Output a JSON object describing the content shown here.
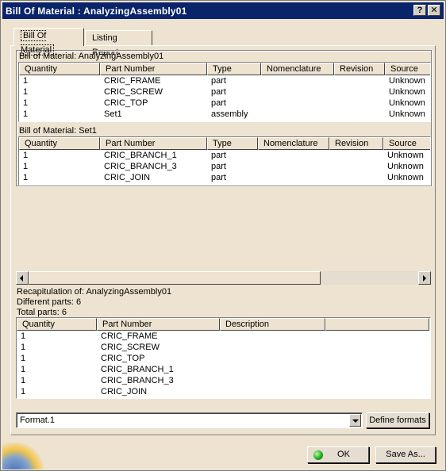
{
  "window": {
    "title": "Bill Of Material : AnalyzingAssembly01",
    "help": "?",
    "close": "✕"
  },
  "tabs": [
    {
      "label": "Bill Of Material"
    },
    {
      "label": "Listing Report"
    }
  ],
  "bom1": {
    "label": "Bill of Material: AnalyzingAssembly01",
    "columns": [
      "Quantity",
      "Part Number",
      "Type",
      "Nomenclature",
      "Revision",
      "Source"
    ],
    "rows": [
      [
        "1",
        "CRIC_FRAME",
        "part",
        "",
        "",
        "Unknown"
      ],
      [
        "1",
        "CRIC_SCREW",
        "part",
        "",
        "",
        "Unknown"
      ],
      [
        "1",
        "CRIC_TOP",
        "part",
        "",
        "",
        "Unknown"
      ],
      [
        "1",
        "Set1",
        "assembly",
        "",
        "",
        "Unknown"
      ]
    ]
  },
  "bom2": {
    "label": "Bill of Material: Set1",
    "columns": [
      "Quantity",
      "Part Number",
      "Type",
      "Nomenclature",
      "Revision",
      "Source"
    ],
    "rows": [
      [
        "1",
        "CRIC_BRANCH_1",
        "part",
        "",
        "",
        "Unknown"
      ],
      [
        "1",
        "CRIC_BRANCH_3",
        "part",
        "",
        "",
        "Unknown"
      ],
      [
        "1",
        "CRIC_JOIN",
        "part",
        "",
        "",
        "Unknown"
      ]
    ]
  },
  "recap": {
    "title": "Recapitulation of: AnalyzingAssembly01",
    "different": "Different parts: 6",
    "total": "Total parts: 6",
    "columns": [
      "Quantity",
      "Part Number",
      "Description",
      ""
    ],
    "rows": [
      [
        "1",
        "CRIC_FRAME",
        "",
        ""
      ],
      [
        "1",
        "CRIC_SCREW",
        "",
        ""
      ],
      [
        "1",
        "CRIC_TOP",
        "",
        ""
      ],
      [
        "1",
        "CRIC_BRANCH_1",
        "",
        ""
      ],
      [
        "1",
        "CRIC_BRANCH_3",
        "",
        ""
      ],
      [
        "1",
        "CRIC_JOIN",
        "",
        ""
      ]
    ]
  },
  "format": {
    "value": "Format.1",
    "define_label": "Define formats"
  },
  "footer": {
    "ok_label": "OK",
    "save_label": "Save As..."
  }
}
